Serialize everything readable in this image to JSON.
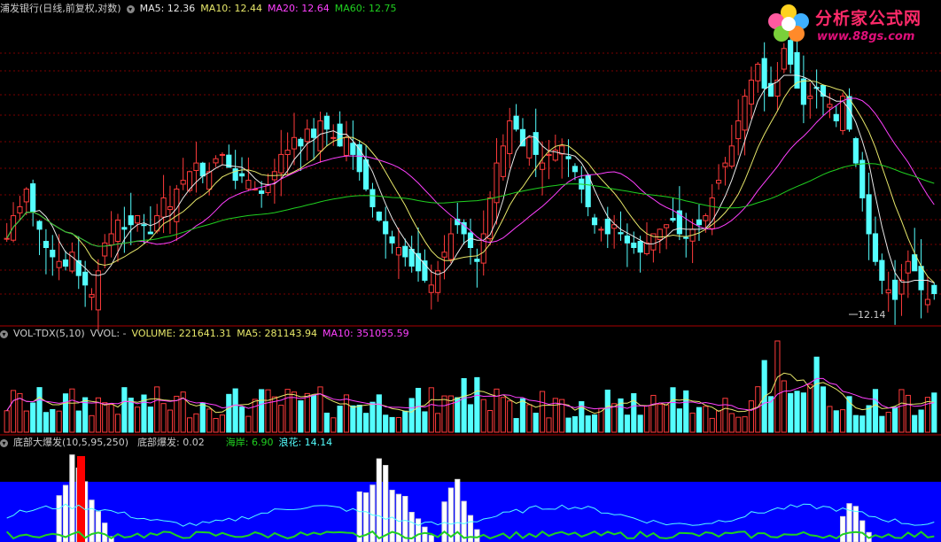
{
  "main_panel": {
    "title": "浦发银行(日线,前复权,对数)",
    "ma5": "MA5: 12.36",
    "ma10": "MA10: 12.44",
    "ma20": "MA20: 12.64",
    "ma60": "MA60: 12.75",
    "low_marker": "12.14"
  },
  "volume_panel": {
    "title": "VOL-TDX(5,10)",
    "vvol": "VVOL: -",
    "volume": "VOLUME: 221641.31",
    "ma5": "MA5: 281143.94",
    "ma10": "MA10: 351055.59"
  },
  "indicator_panel": {
    "title": "底部大爆发(10,5,95,250)",
    "value": "底部爆发: 0.02",
    "haian": "海岸: 6.90",
    "langhua": "浪花: 14.14"
  },
  "logo": {
    "title": "分析家公式网",
    "url": "www.88gs.com"
  },
  "colors": {
    "up": "#ff3b3b",
    "down": "#54ffff",
    "ma5": "#e8e8e8",
    "ma10": "#e8e86a",
    "ma20": "#ff40ff",
    "ma60": "#20d020",
    "ind_blue": "#0000ff",
    "ind_red": "#ff0000"
  },
  "chart_data": {
    "type": "candlestick",
    "closes": [
      12.95,
      13.2,
      13.3,
      13.5,
      13.25,
      13.05,
      12.85,
      12.75,
      12.7,
      12.65,
      12.8,
      12.55,
      12.45,
      12.35,
      12.6,
      12.9,
      13.0,
      13.15,
      13.05,
      13.1,
      13.2,
      13.1,
      13.0,
      13.2,
      13.4,
      13.3,
      13.5,
      13.6,
      13.7,
      13.8,
      13.65,
      13.7,
      13.85,
      13.9,
      13.75,
      13.6,
      13.65,
      13.6,
      13.5,
      13.45,
      13.55,
      13.7,
      13.9,
      13.95,
      14.1,
      14.0,
      14.2,
      14.1,
      14.3,
      14.2,
      14.1,
      14.0,
      14.1,
      13.9,
      13.7,
      13.5,
      13.3,
      13.15,
      13.0,
      12.9,
      12.85,
      12.75,
      12.65,
      12.6,
      12.5,
      12.45,
      12.6,
      12.8,
      13.0,
      13.1,
      13.0,
      12.85,
      12.7,
      13.0,
      13.4,
      13.8,
      14.0,
      14.3,
      14.2,
      14.0,
      14.1,
      13.9,
      13.8,
      13.9,
      13.95,
      14.0,
      13.85,
      13.7,
      13.5,
      13.3,
      13.1,
      13.05,
      13.0,
      13.1,
      13.0,
      12.9,
      12.85,
      12.8,
      12.9,
      13.0,
      13.05,
      13.1,
      13.15,
      13.0,
      12.95,
      13.05,
      13.1,
      13.2,
      13.4,
      13.6,
      13.8,
      14.0,
      14.3,
      14.6,
      14.8,
      15.0,
      14.7,
      14.6,
      14.8,
      15.2,
      15.0,
      14.7,
      14.5,
      14.6,
      14.7,
      14.6,
      14.5,
      14.3,
      14.6,
      14.2,
      13.8,
      13.4,
      13.0,
      12.7,
      12.5,
      12.4,
      12.3,
      12.5,
      12.7,
      12.6,
      12.4,
      12.3,
      12.36
    ],
    "volume_ma": [
      "MA5",
      "MA10"
    ],
    "indicator_series": [
      "底部爆发",
      "海岸",
      "浪花"
    ]
  }
}
